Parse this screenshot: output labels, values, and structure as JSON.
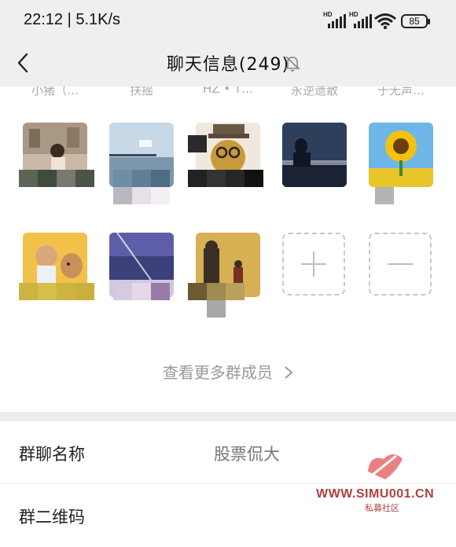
{
  "status_bar": {
    "time": "22:12 | 5.1K/s",
    "sim1": "HD",
    "sim2": "HD",
    "battery": "85"
  },
  "nav": {
    "title": "聊天信息(249)",
    "back_icon": "chevron-left-icon",
    "mute_icon": "bell-off-icon"
  },
  "members": {
    "top_names": [
      "小猪（…",
      "扶摇",
      "HZ • T…",
      "永逆遗散",
      "于无声…"
    ],
    "row2_names": [
      "",
      "",
      "",
      "",
      ""
    ],
    "view_more": "查看更多群成员",
    "add_icon": "plus-icon",
    "remove_icon": "minus-icon"
  },
  "settings": {
    "group_name_label": "群聊名称",
    "group_name_value": "股票侃大",
    "qr_label": "群二维码"
  },
  "watermark": {
    "url": "WWW.SIMU001.CN",
    "subtitle": "私募社区"
  },
  "colors": {
    "header_bg": "#efefef",
    "watermark": "#b0413e"
  }
}
